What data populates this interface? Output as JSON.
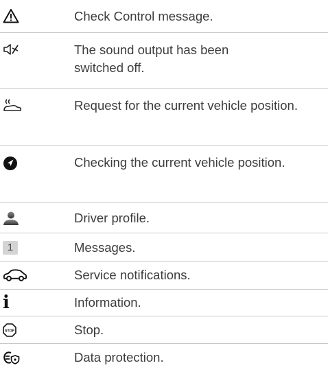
{
  "rows": [
    {
      "icon": "warning-triangle-icon",
      "text": "Check Control message."
    },
    {
      "icon": "speaker-muted-icon",
      "text": "The sound output has been switched off."
    },
    {
      "icon": "vehicle-position-request-icon",
      "text": "Request for the current vehicle position."
    },
    {
      "icon": "navigation-arrow-icon",
      "text": "Checking the current vehicle position."
    },
    {
      "icon": "driver-profile-icon",
      "text": "Driver profile."
    },
    {
      "icon": "messages-badge-icon",
      "text": "Messages.",
      "badge": "1"
    },
    {
      "icon": "car-outline-icon",
      "text": "Service notifications."
    },
    {
      "icon": "info-icon",
      "text": "Information.",
      "glyph": "i"
    },
    {
      "icon": "stop-sign-icon",
      "text": "Stop.",
      "glyph": "STOP"
    },
    {
      "icon": "data-protection-icon",
      "text": "Data protection."
    }
  ]
}
